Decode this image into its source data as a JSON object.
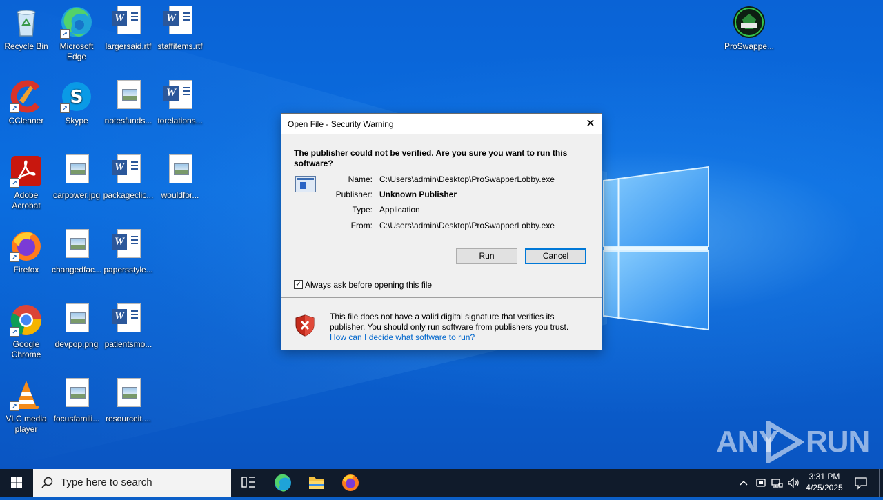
{
  "desktop": {
    "icons": [
      {
        "label": "Recycle Bin",
        "icon": "recycle-bin-icon"
      },
      {
        "label": "Microsoft Edge",
        "icon": "edge-icon"
      },
      {
        "label": "largersaid.rtf",
        "icon": "word-document-icon"
      },
      {
        "label": "staffitems.rtf",
        "icon": "word-document-icon"
      },
      {
        "label": "ProSwappe...",
        "icon": "proswapper-icon"
      },
      {
        "label": "CCleaner",
        "icon": "ccleaner-icon"
      },
      {
        "label": "Skype",
        "icon": "skype-icon"
      },
      {
        "label": "notesfunds...",
        "icon": "image-file-icon"
      },
      {
        "label": "torelations...",
        "icon": "word-document-icon"
      },
      {
        "label": "Adobe Acrobat",
        "icon": "acrobat-icon"
      },
      {
        "label": "carpower.jpg",
        "icon": "image-file-icon"
      },
      {
        "label": "packageclic...",
        "icon": "word-document-icon"
      },
      {
        "label": "wouldfor...",
        "icon": "image-file-icon"
      },
      {
        "label": "Firefox",
        "icon": "firefox-icon"
      },
      {
        "label": "changedfac...",
        "icon": "image-file-icon"
      },
      {
        "label": "papersstyle...",
        "icon": "word-document-icon"
      },
      {
        "label": "Google Chrome",
        "icon": "chrome-icon"
      },
      {
        "label": "devpop.png",
        "icon": "image-file-icon"
      },
      {
        "label": "patientsmo...",
        "icon": "word-document-icon"
      },
      {
        "label": "VLC media player",
        "icon": "vlc-icon"
      },
      {
        "label": "focusfamili...",
        "icon": "image-file-icon"
      },
      {
        "label": "resourceit....",
        "icon": "image-file-icon"
      }
    ]
  },
  "dialog": {
    "title": "Open File - Security Warning",
    "question": "The publisher could not be verified.  Are you sure you want to run this software?",
    "fields": {
      "name_label": "Name:",
      "name_value": "C:\\Users\\admin\\Desktop\\ProSwapperLobby.exe",
      "publisher_label": "Publisher:",
      "publisher_value": "Unknown Publisher",
      "type_label": "Type:",
      "type_value": "Application",
      "from_label": "From:",
      "from_value": "C:\\Users\\admin\\Desktop\\ProSwapperLobby.exe"
    },
    "run_label": "Run",
    "cancel_label": "Cancel",
    "checkbox_label": "Always ask before opening this file",
    "checkbox_checked": true,
    "footer_text": "This file does not have a valid digital signature that verifies its publisher.  You should only run software from publishers you trust.",
    "help_link": "How can I decide what software to run?"
  },
  "taskbar": {
    "search_placeholder": "Type here to search",
    "time": "3:31 PM",
    "date": "4/25/2025"
  },
  "watermark": {
    "left": "ANY",
    "right": "RUN"
  },
  "colors": {
    "desktop_blue": "#0b5fc8",
    "taskbar": "#101b2b",
    "accent": "#0078d7",
    "link": "#0066cc"
  }
}
